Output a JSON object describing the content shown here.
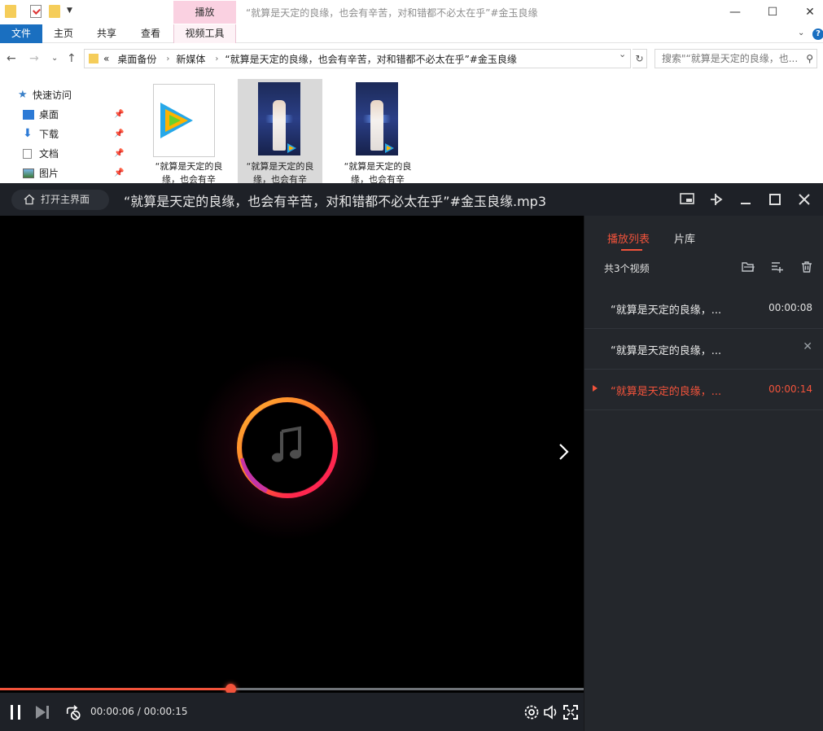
{
  "explorer": {
    "title": "“就算是天定的良缘，也会有辛苦，对和错都不必太在乎”#金玉良缘",
    "context_tab_header": "播放",
    "ribbon_tabs": [
      "文件",
      "主页",
      "共享",
      "查看",
      "视频工具"
    ],
    "address_path": [
      "桌面备份",
      "新媒体",
      "“就算是天定的良缘，也会有辛苦，对和错都不必太在乎”#金玉良缘"
    ],
    "address_prefix": "«",
    "search_placeholder": "搜索\"“就算是天定的良缘，也...",
    "nav": {
      "quick_access": "快速访问",
      "items": [
        "桌面",
        "下载",
        "文档",
        "图片"
      ]
    },
    "files": [
      {
        "name_line1": "“就算是天定的良",
        "name_line2": "缘，也会有辛"
      },
      {
        "name_line1": "“就算是天定的良",
        "name_line2": "缘，也会有辛"
      },
      {
        "name_line1": "“就算是天定的良",
        "name_line2": "缘，也会有辛"
      }
    ]
  },
  "player": {
    "home_button": "打开主界面",
    "title": "“就算是天定的良缘，也会有辛苦，对和错都不必太在乎”#金玉良缘.mp3",
    "progress_fraction": 0.395,
    "time_current": "00:00:06",
    "time_total": "00:00:15",
    "time_display": "00:00:06 / 00:00:15",
    "sidebar": {
      "tabs": [
        "播放列表",
        "片库"
      ],
      "count": "共3个视频",
      "playlist": [
        {
          "name": "“就算是天定的良缘，...",
          "duration": "00:00:08",
          "active": false
        },
        {
          "name": "“就算是天定的良缘，...",
          "duration": "",
          "active": false
        },
        {
          "name": "“就算是天定的良缘，...",
          "duration": "00:00:14",
          "active": true
        }
      ]
    },
    "colors": {
      "accent": "#f2533b",
      "panel": "#24272c",
      "bar": "#1e2127"
    }
  }
}
